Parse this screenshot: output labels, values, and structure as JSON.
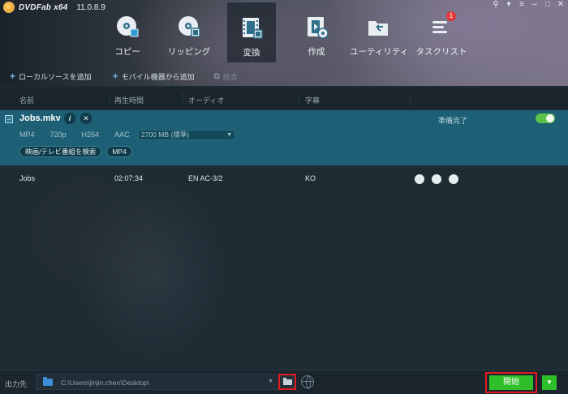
{
  "app": {
    "name": "DVDFab x64",
    "version": "11.0.8.9"
  },
  "nav": [
    {
      "label": "コピー",
      "icon": "disc-copy-icon"
    },
    {
      "label": "リッピング",
      "icon": "disc-rip-icon"
    },
    {
      "label": "変換",
      "icon": "film-convert-icon",
      "active": true
    },
    {
      "label": "作成",
      "icon": "film-create-icon"
    },
    {
      "label": "ユーティリティ",
      "icon": "utility-folder-icon"
    },
    {
      "label": "タスクリスト",
      "icon": "task-list-icon",
      "badge": "1"
    }
  ],
  "subtoolbar": {
    "add_local": "ローカルソースを追加",
    "add_mobile": "モバイル機器から追加",
    "merge": "結合"
  },
  "columns": {
    "name": "名前",
    "playtime": "再生時間",
    "audio": "オーディオ",
    "subtitle": "字幕"
  },
  "file": {
    "name": "Jobs.mkv",
    "status": "準備完了",
    "format": "MP4",
    "resolution": "720p",
    "video_codec": "H264",
    "audio_codec": "AAC",
    "size": "2700 MB (標準)",
    "chip_search": "映画/テレビ番組を検索",
    "chip_format": "MP4"
  },
  "track": {
    "title": "Jobs",
    "duration": "02:07:34",
    "audio": "EN AC-3/2",
    "subtitle": "KO"
  },
  "footer": {
    "output_label": "出力先",
    "path": "C:\\Users\\jinjin.chen\\Desktop\\",
    "start": "開始"
  },
  "colors": {
    "accent_blue": "#1d5f75",
    "start_green": "#2fbf2a",
    "highlight_red": "#e11b22"
  }
}
